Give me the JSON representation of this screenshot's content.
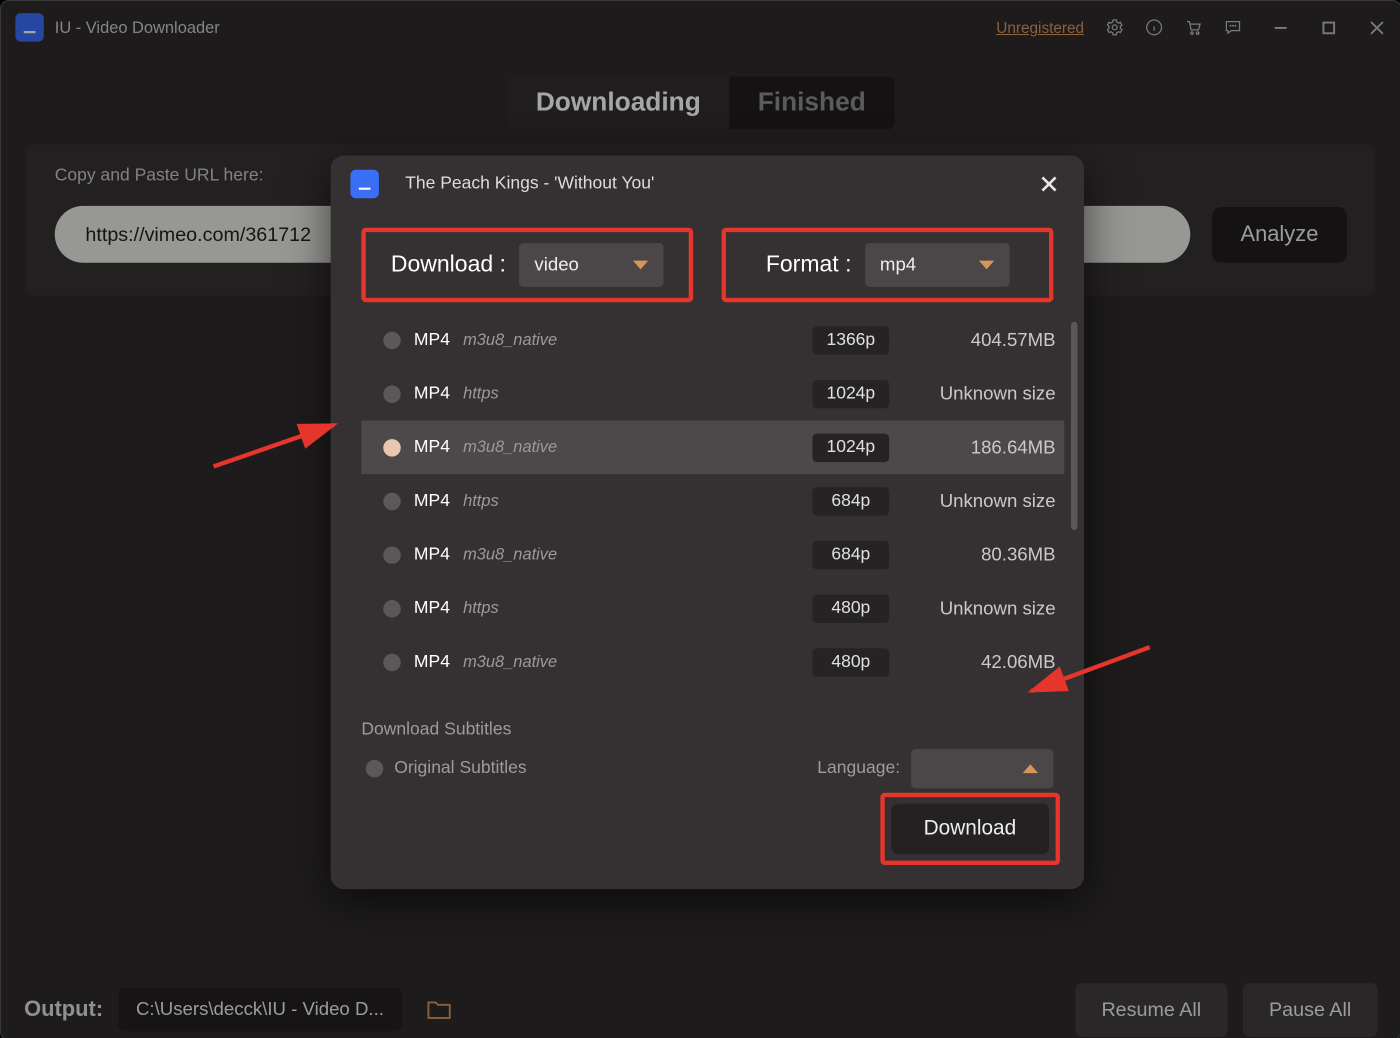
{
  "title": "IU - Video Downloader",
  "unregistered": "Unregistered",
  "tabs": {
    "downloading": "Downloading",
    "finished": "Finished"
  },
  "url_label": "Copy and Paste URL here:",
  "url_value": "https://vimeo.com/361712",
  "analyze": "Analyze",
  "output_label": "Output:",
  "output_path": "C:\\Users\\decck\\IU - Video D...",
  "resume_all": "Resume All",
  "pause_all": "Pause All",
  "dialog": {
    "title": "The Peach Kings - 'Without You'",
    "download_label": "Download :",
    "download_value": "video",
    "format_label": "Format :",
    "format_value": "mp4",
    "rows": [
      {
        "codec": "MP4",
        "proto": "m3u8_native",
        "res": "1366p",
        "size": "404.57MB",
        "selected": false
      },
      {
        "codec": "MP4",
        "proto": "https",
        "res": "1024p",
        "size": "Unknown size",
        "selected": false
      },
      {
        "codec": "MP4",
        "proto": "m3u8_native",
        "res": "1024p",
        "size": "186.64MB",
        "selected": true
      },
      {
        "codec": "MP4",
        "proto": "https",
        "res": "684p",
        "size": "Unknown size",
        "selected": false
      },
      {
        "codec": "MP4",
        "proto": "m3u8_native",
        "res": "684p",
        "size": "80.36MB",
        "selected": false
      },
      {
        "codec": "MP4",
        "proto": "https",
        "res": "480p",
        "size": "Unknown size",
        "selected": false
      },
      {
        "codec": "MP4",
        "proto": "m3u8_native",
        "res": "480p",
        "size": "42.06MB",
        "selected": false
      }
    ],
    "subtitles_label": "Download Subtitles",
    "orig_subs": "Original Subtitles",
    "language_label": "Language:",
    "download_btn": "Download"
  }
}
